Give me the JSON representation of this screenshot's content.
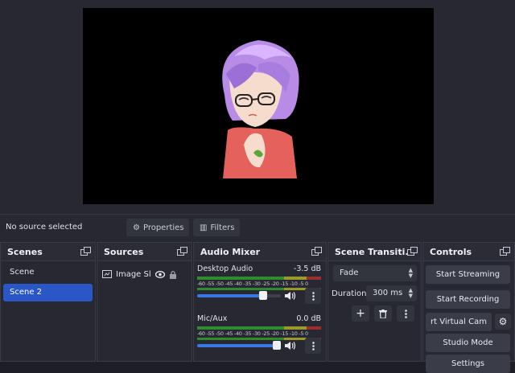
{
  "status": {
    "no_source": "No source selected"
  },
  "source_toolbar": {
    "properties_label": "Properties",
    "filters_label": "Filters"
  },
  "scenes": {
    "title": "Scenes",
    "items": [
      {
        "label": "Scene"
      },
      {
        "label": "Scene 2",
        "selected": true
      }
    ]
  },
  "sources": {
    "title": "Sources",
    "items": [
      {
        "label": "Image Slic"
      }
    ]
  },
  "mixer": {
    "title": "Audio Mixer",
    "ticks": "-60 -55 -50 -45 -40 -35 -30 -25 -20 -15 -10 -5 0",
    "channels": [
      {
        "name": "Desktop Audio",
        "db": "-3.5 dB",
        "volume": 0.82
      },
      {
        "name": "Mic/Aux",
        "db": "0.0 dB",
        "volume": 1.0
      }
    ]
  },
  "transitions": {
    "title": "Scene Transiti...",
    "selected": "Fade",
    "duration_label": "Duration",
    "duration_value": "300 ms"
  },
  "controls": {
    "title": "Controls",
    "start_streaming": "Start Streaming",
    "start_recording": "Start Recording",
    "virtual_cam": "rt Virtual Cam",
    "studio_mode": "Studio Mode",
    "settings": "Settings"
  },
  "colors": {
    "accent": "#2a56c6",
    "panel": "#272831",
    "background": "#1e1f26"
  }
}
